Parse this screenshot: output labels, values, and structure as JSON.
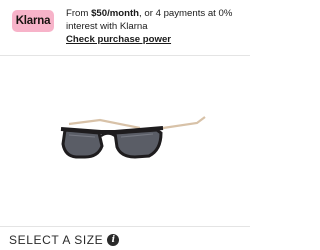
{
  "colors": {
    "klarna_pink": "#f7b3c9",
    "text": "#1a1a1a",
    "divider": "#e4e4e4",
    "frame": "#1e1c1e",
    "temple": "#d8c2a8",
    "lens": "#5a5d66"
  },
  "klarna": {
    "logo_text": "Klarna",
    "line1_prefix": "From ",
    "amount": "$50/month",
    "line1_suffix": ", or 4 payments at 0%",
    "line2": "interest with Klarna",
    "link": "Check purchase power"
  },
  "product": {
    "image_icon": "sunglasses-product-image"
  },
  "size_selector": {
    "label": "SELECT A SIZE",
    "info_icon": "i"
  }
}
